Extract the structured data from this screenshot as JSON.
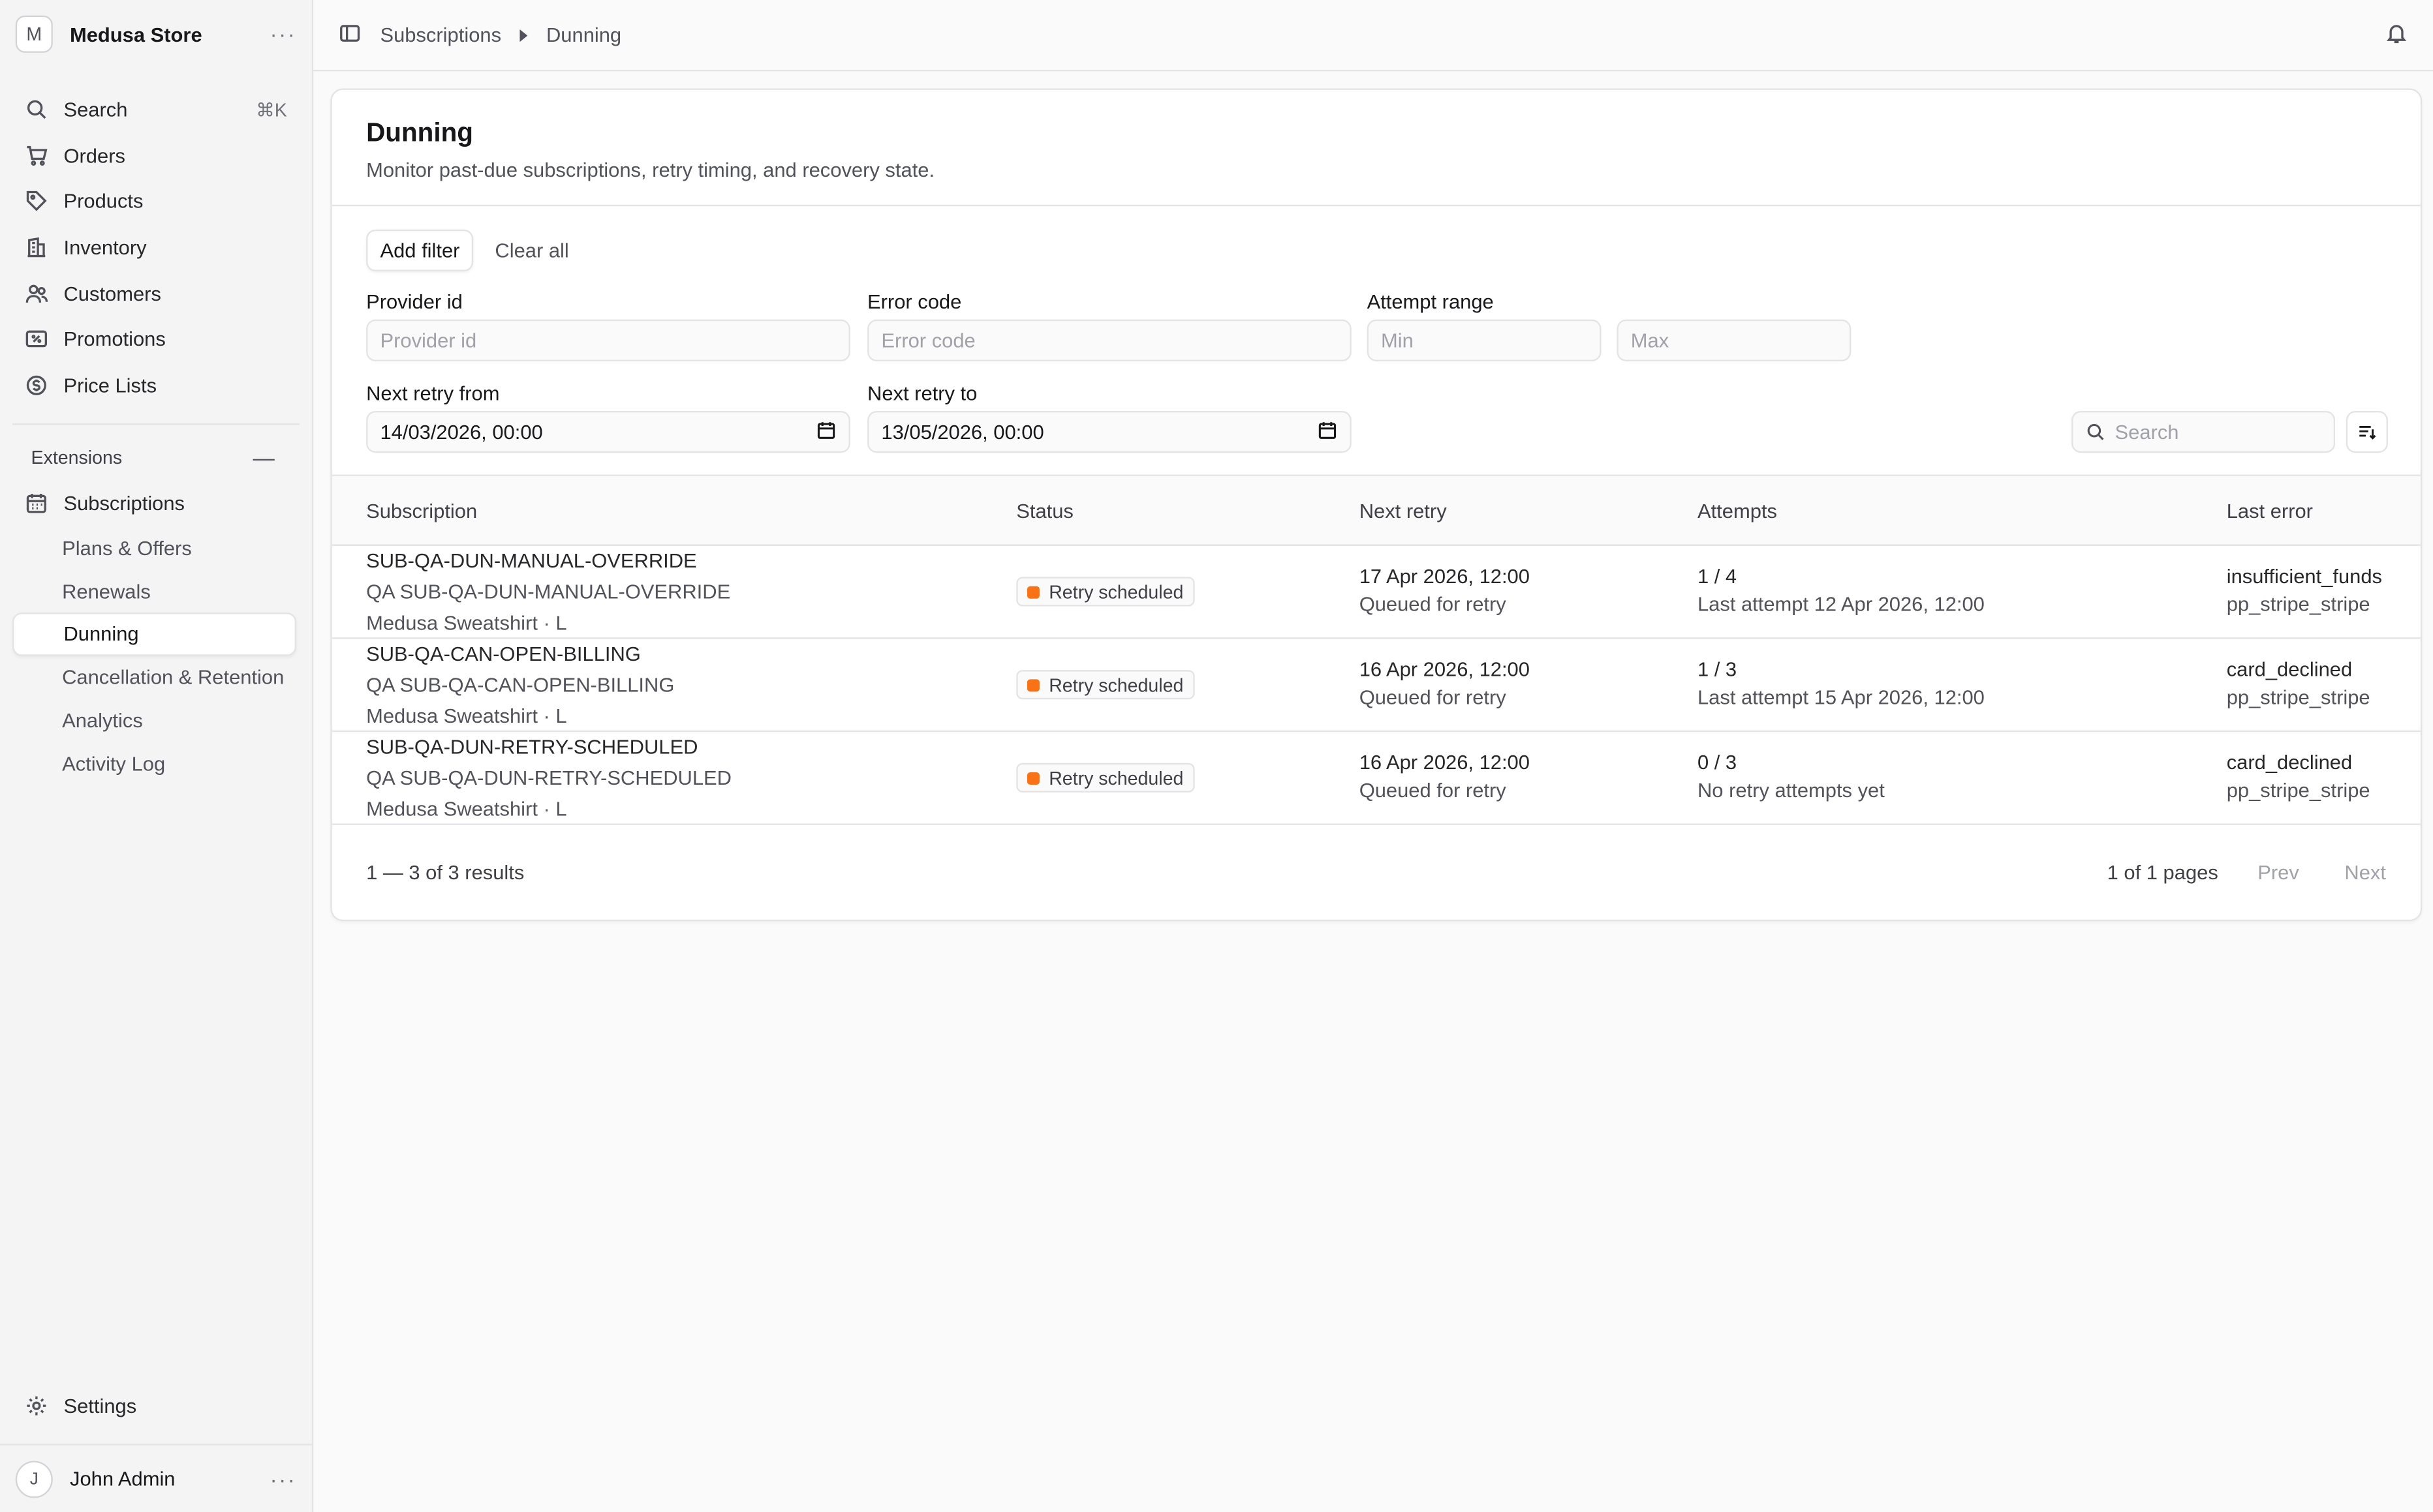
{
  "store": {
    "initial": "M",
    "name": "Medusa Store"
  },
  "nav": {
    "search_label": "Search",
    "search_shortcut": "⌘K",
    "items": [
      {
        "label": "Orders",
        "icon": "cart-icon"
      },
      {
        "label": "Products",
        "icon": "tag-icon"
      },
      {
        "label": "Inventory",
        "icon": "building-icon"
      },
      {
        "label": "Customers",
        "icon": "users-icon"
      },
      {
        "label": "Promotions",
        "icon": "receipt-percent-icon"
      },
      {
        "label": "Price Lists",
        "icon": "currency-dollar-icon"
      }
    ]
  },
  "extensions": {
    "heading": "Extensions",
    "subscriptions_label": "Subscriptions",
    "items": [
      "Plans & Offers",
      "Renewals",
      "Dunning",
      "Cancellation & Retention",
      "Analytics",
      "Activity Log"
    ]
  },
  "settings_label": "Settings",
  "user": {
    "initial": "J",
    "name": "John Admin"
  },
  "breadcrumb": {
    "parent": "Subscriptions",
    "current": "Dunning"
  },
  "page": {
    "title": "Dunning",
    "subtitle": "Monitor past-due subscriptions, retry timing, and recovery state."
  },
  "filters": {
    "add_filter": "Add filter",
    "clear_all": "Clear all",
    "provider_id_label": "Provider id",
    "provider_id_placeholder": "Provider id",
    "error_code_label": "Error code",
    "error_code_placeholder": "Error code",
    "attempt_range_label": "Attempt range",
    "min_placeholder": "Min",
    "max_placeholder": "Max",
    "next_retry_from_label": "Next retry from",
    "next_retry_from_value": "14/03/2026, 00:00",
    "next_retry_to_label": "Next retry to",
    "next_retry_to_value": "13/05/2026, 00:00",
    "search_placeholder": "Search"
  },
  "table": {
    "columns": [
      "Subscription",
      "Status",
      "Next retry",
      "Attempts",
      "Last error"
    ],
    "rows": [
      {
        "id": "SUB-QA-DUN-MANUAL-OVERRIDE",
        "customer": "QA SUB-QA-DUN-MANUAL-OVERRIDE",
        "product": "Medusa Sweatshirt · L",
        "status": "Retry scheduled",
        "next_retry": "17 Apr 2026, 12:00",
        "next_retry_note": "Queued for retry",
        "attempts": "1 / 4",
        "attempts_note": "Last attempt 12 Apr 2026, 12:00",
        "error": "insufficient_funds",
        "provider": "pp_stripe_stripe"
      },
      {
        "id": "SUB-QA-CAN-OPEN-BILLING",
        "customer": "QA SUB-QA-CAN-OPEN-BILLING",
        "product": "Medusa Sweatshirt · L",
        "status": "Retry scheduled",
        "next_retry": "16 Apr 2026, 12:00",
        "next_retry_note": "Queued for retry",
        "attempts": "1 / 3",
        "attempts_note": "Last attempt 15 Apr 2026, 12:00",
        "error": "card_declined",
        "provider": "pp_stripe_stripe"
      },
      {
        "id": "SUB-QA-DUN-RETRY-SCHEDULED",
        "customer": "QA SUB-QA-DUN-RETRY-SCHEDULED",
        "product": "Medusa Sweatshirt · L",
        "status": "Retry scheduled",
        "next_retry": "16 Apr 2026, 12:00",
        "next_retry_note": "Queued for retry",
        "attempts": "0 / 3",
        "attempts_note": "No retry attempts yet",
        "error": "card_declined",
        "provider": "pp_stripe_stripe"
      }
    ]
  },
  "pagination": {
    "results": "1 — 3 of 3 results",
    "pages": "1 of 1 pages",
    "prev": "Prev",
    "next": "Next"
  },
  "colors": {
    "status_dot": "#f97316",
    "accent_bg": "#ffffff"
  }
}
